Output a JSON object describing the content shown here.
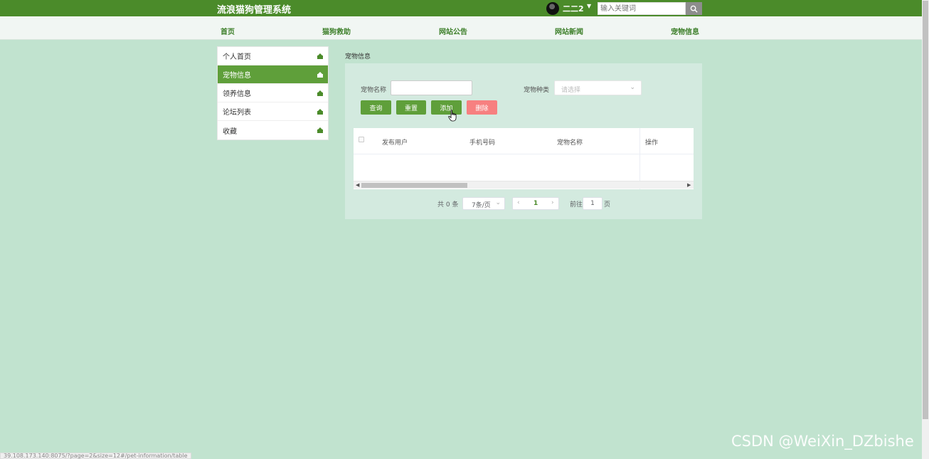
{
  "header": {
    "app_title": "流浪猫狗管理系统",
    "username": "二二2",
    "search_placeholder": "输入关键词"
  },
  "nav": [
    "首页",
    "猫狗救助",
    "网站公告",
    "网站新闻",
    "宠物信息"
  ],
  "sidebar": {
    "items": [
      {
        "label": "个人首页"
      },
      {
        "label": "宠物信息"
      },
      {
        "label": "领养信息"
      },
      {
        "label": "论坛列表"
      },
      {
        "label": "收藏"
      }
    ]
  },
  "main": {
    "breadcrumb": "宠物信息",
    "filters": {
      "name_label": "宠物名称",
      "name_value": "",
      "type_label": "宠物种类",
      "type_placeholder": "请选择"
    },
    "buttons": {
      "query": "查询",
      "reset": "重置",
      "add": "添加",
      "delete": "删除"
    },
    "table": {
      "columns": [
        "发布用户",
        "手机号码",
        "宠物名称",
        "操作"
      ],
      "rows": []
    },
    "pagination": {
      "total_text": "共 0 条",
      "page_size": "7条/页",
      "current_page": "1",
      "goto_label": "前往",
      "goto_value": "1",
      "page_suffix": "页"
    }
  },
  "status_bar": {
    "url": "39.108.173.140:8075/?page=2&size=12#/pet-information/table"
  },
  "watermark": "CSDN @WeiXin_DZbishe",
  "colors": {
    "accent": "#4b8b2a",
    "danger": "#f78080",
    "background": "#c1e3cf"
  }
}
